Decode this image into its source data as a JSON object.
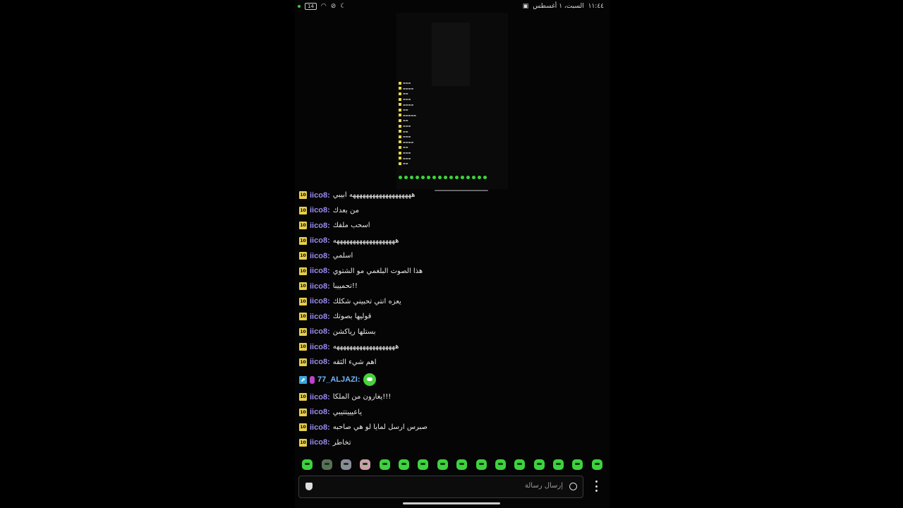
{
  "status_bar": {
    "time": "١١:٤٤",
    "date": "السبت، ١ أغسطس",
    "battery": "14"
  },
  "chat": {
    "messages": [
      {
        "user": "iico8:",
        "text": "هههههههههههههههههههه ابيبي"
      },
      {
        "user": "iico8:",
        "text": "من بعدك"
      },
      {
        "user": "iico8:",
        "text": "اسحب ملفك"
      },
      {
        "user": "iico8:",
        "text": "هههههههههههههههههههه"
      },
      {
        "user": "iico8:",
        "text": "اسلمي"
      },
      {
        "user": "iico8:",
        "text": "هذا الصوت البلغمي مو الشتوي"
      },
      {
        "user": "iico8:",
        "text": "تحمييبا!!"
      },
      {
        "user": "iico8:",
        "text": "يعزه انتي تحبيني شكلك"
      },
      {
        "user": "iico8:",
        "text": "قوليها بصوتك"
      },
      {
        "user": "iico8:",
        "text": "بستلها رياكشن"
      },
      {
        "user": "iico8:",
        "text": "هههههههههههههههههههه"
      },
      {
        "user": "iico8:",
        "text": "اهم شيء الثقه"
      },
      {
        "user": "77_ALJAZI:",
        "text": ""
      },
      {
        "user": "iico8:",
        "text": "يغارون من الملكا!!!"
      },
      {
        "user": "iico8:",
        "text": "ياعيييتتيبي"
      },
      {
        "user": "iico8:",
        "text": "صبرس ارسل لمايا لو هي صاحبه"
      },
      {
        "user": "iico8:",
        "text": "تخاطر"
      }
    ],
    "badge_label": "10"
  },
  "composer": {
    "placeholder": "إرسال رسالة"
  },
  "emotes": [
    "emote-1",
    "emote-2",
    "emote-3",
    "emote-4",
    "emote-5",
    "emote-6",
    "emote-7",
    "emote-8",
    "emote-9",
    "emote-10",
    "emote-11",
    "emote-12",
    "emote-13",
    "emote-14",
    "emote-15",
    "emote-16"
  ]
}
